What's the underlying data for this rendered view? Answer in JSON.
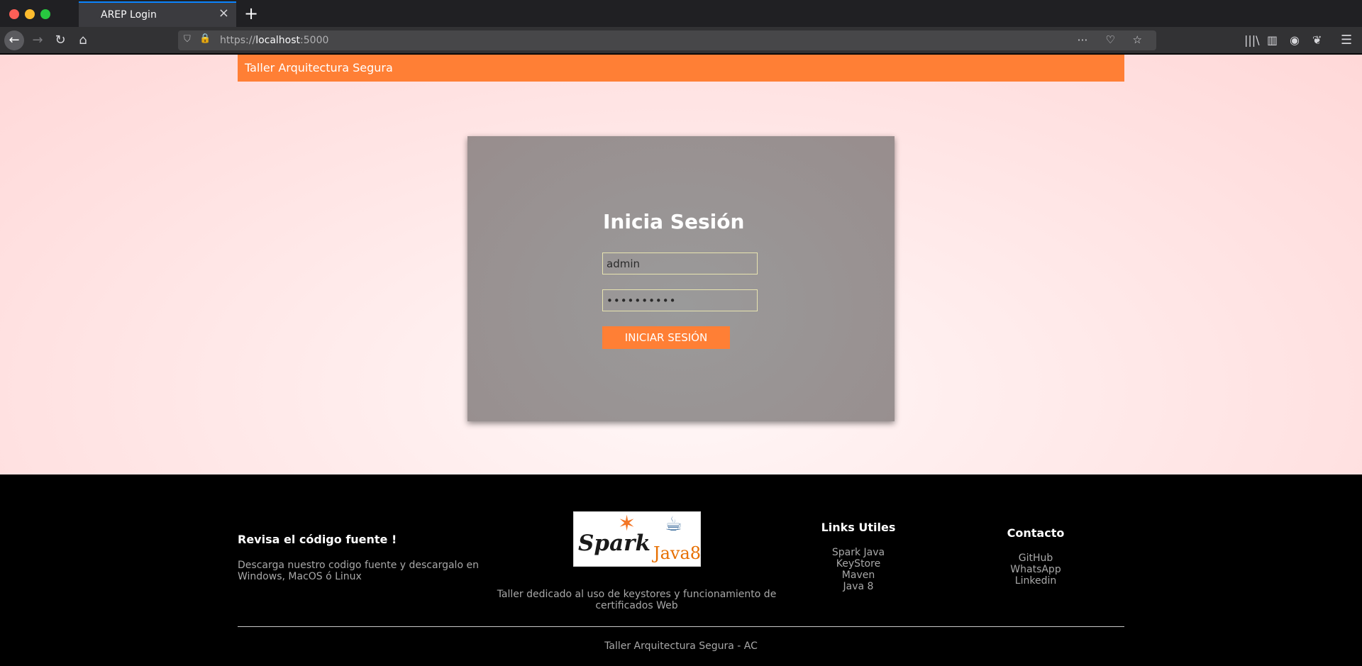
{
  "browser": {
    "tab_title": "AREP Login",
    "tab_close": "×",
    "new_tab": "+",
    "url_scheme": "https://",
    "url_host": "localhost",
    "url_port": ":5000",
    "icons": {
      "back": "←",
      "forward": "→",
      "reload": "↻",
      "home": "⌂",
      "shield": "⛉",
      "lock": "🔒",
      "page_actions": "⋯ ♡ ☆",
      "library": "|||\\",
      "sidebar": "▥",
      "account": "◉",
      "extension": "❦",
      "menu": "☰"
    }
  },
  "header": {
    "title": "Taller Arquitectura Segura"
  },
  "login": {
    "title": "Inicia Sesión",
    "username_value": "admin",
    "password_value": "••••••••••",
    "submit_label": "INICIAR SESIÓN"
  },
  "footer": {
    "source": {
      "heading": "Revisa el código fuente !",
      "text": "Descarga nuestro codigo fuente y descargalo en Windows, MacOS ó Linux"
    },
    "logo": {
      "spark_text": "Spark",
      "java_text": "Java8"
    },
    "center_text": "Taller dedicado al uso de keystores y funcionamiento de certificados Web",
    "links": {
      "heading": "Links Utiles",
      "items": [
        "Spark Java",
        "KeyStore",
        "Maven",
        "Java 8"
      ]
    },
    "contact": {
      "heading": "Contacto",
      "items": [
        "GitHub",
        "WhatsApp",
        "Linkedin"
      ]
    },
    "copyright": "Taller Arquitectura Segura - AC"
  },
  "colors": {
    "accent": "#ff7f35",
    "card": "#999494",
    "footer_bg": "#000000"
  }
}
